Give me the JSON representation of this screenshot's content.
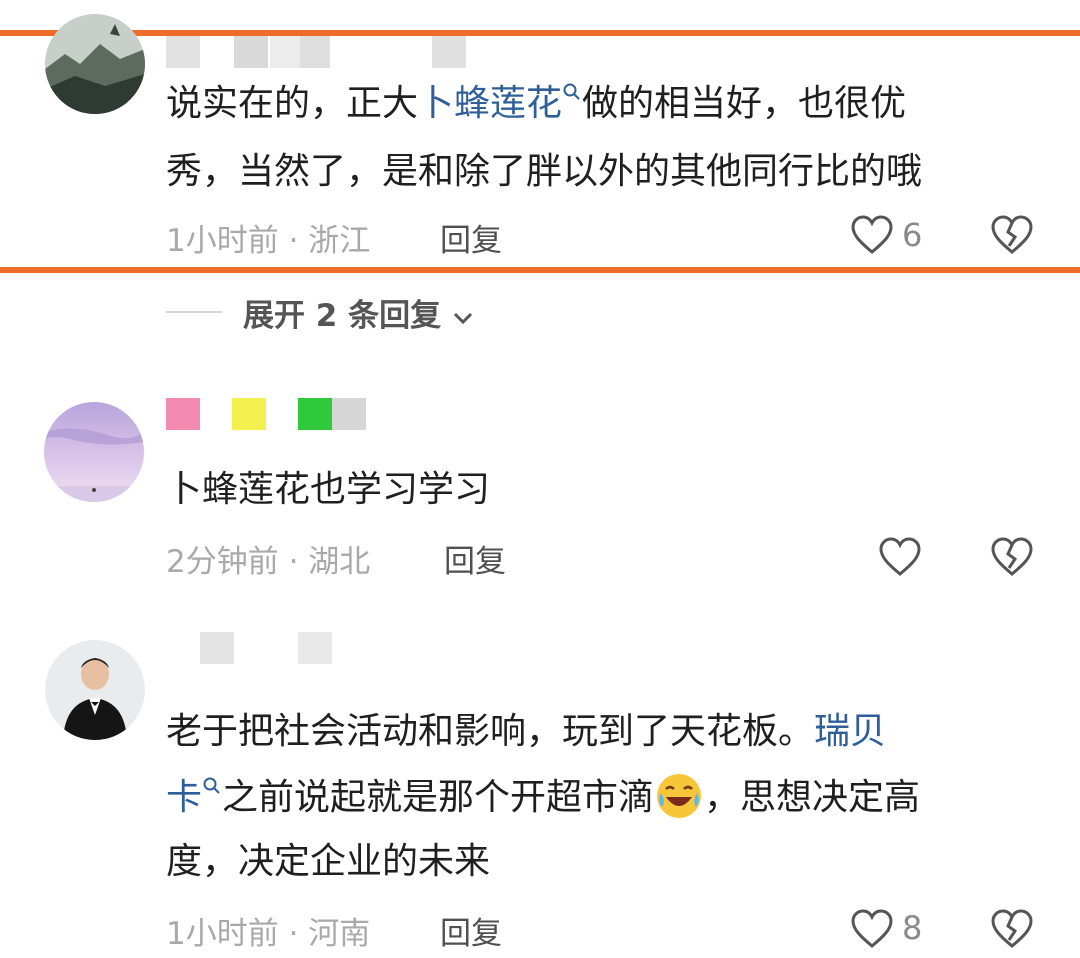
{
  "comments": [
    {
      "lines": [
        [
          "说实在的，正大",
          "卜蜂莲花",
          "做的相当好，也很优"
        ],
        [
          "秀，当然了，是和除了胖以外的其他同行比的哦"
        ]
      ],
      "time": "1小时前 · 浙江",
      "reply": "回复",
      "likes": "6"
    },
    {
      "text": "卜蜂莲花也学习学习",
      "time": "2分钟前 · 湖北",
      "reply": "回复"
    },
    {
      "line1_a": "老于把社会活动和影响，玩到了天花板。",
      "line1_link": "瑞贝",
      "line2_link": "卡",
      "line2_a": "之前说起就是那个开超市滴",
      "line2_b": "，思想决定高",
      "line3": "度，决定企业的未来",
      "time": "1小时前 · 河南",
      "reply": "回复",
      "likes": "8"
    }
  ],
  "expand_replies": "展开 2 条回复",
  "colors": {
    "highlight": "#ef6b2a",
    "link": "#2f5f99",
    "meta": "#a9a9a9"
  },
  "icons": [
    "like-heart-icon",
    "dislike-broken-heart-icon",
    "search-icon",
    "chevron-down-icon",
    "laughing-emoji-icon"
  ]
}
